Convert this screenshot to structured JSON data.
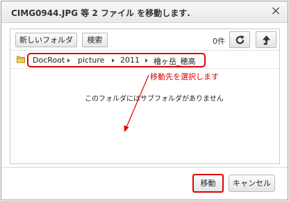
{
  "dialog": {
    "title": "CIMG0944.JPG 等 2 ファイル を移動します.",
    "close_glyph": "×"
  },
  "toolbar": {
    "new_folder_label": "新しいフォルダ",
    "search_label": "検索",
    "item_count": "0件"
  },
  "breadcrumb": {
    "items": [
      "DocRoot",
      "picture",
      "2011",
      "檜ヶ岳_穂高"
    ]
  },
  "annotation": {
    "text": "移動先を選択します",
    "color": "#e00000"
  },
  "content": {
    "empty_message": "このフォルダにはサブフォルダがありません"
  },
  "footer": {
    "move_label": "移動",
    "cancel_label": "キャンセル"
  },
  "icons": [
    "close-icon",
    "refresh-icon",
    "up-arrow-icon",
    "folder-icon",
    "chevron-right-icon"
  ]
}
